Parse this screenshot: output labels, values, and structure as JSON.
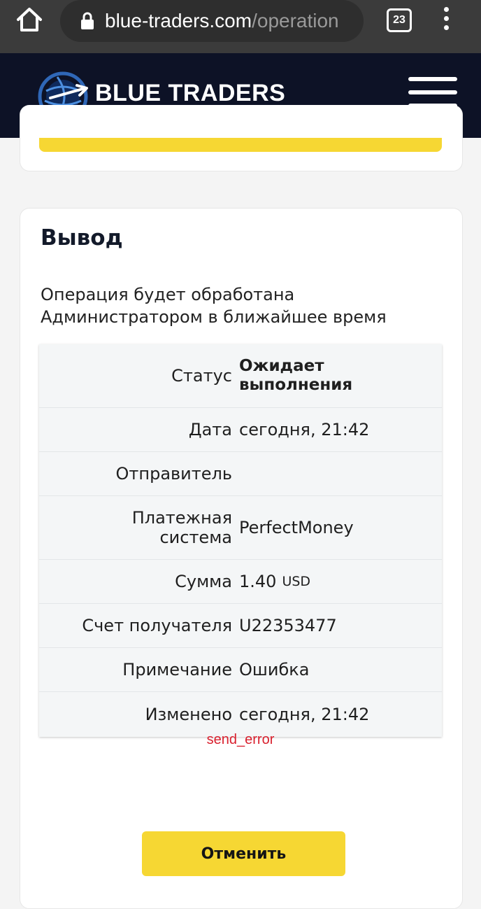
{
  "browser": {
    "url_domain": "blue-traders.com",
    "url_path": "/operation",
    "tab_count": "23"
  },
  "site": {
    "brand": "BLUE TRADERS"
  },
  "card": {
    "title": "Вывод",
    "description": "Операция будет обработана Администратором в ближайшее время"
  },
  "details": [
    {
      "label": "Статус",
      "value": "Ожидает выполнения"
    },
    {
      "label": "Дата",
      "value": "сегодня, 21:42"
    },
    {
      "label": "Отправитель",
      "value": ""
    },
    {
      "label": "Платежная система",
      "value": "PerfectMoney"
    },
    {
      "label": "Сумма",
      "value": "1.40",
      "currency": "USD"
    },
    {
      "label": "Счет получателя",
      "value": "U22353477"
    },
    {
      "label": "Примечание",
      "value": "Ошибка"
    },
    {
      "label": "Изменено",
      "value": "сегодня, 21:42"
    }
  ],
  "error_code": "send_error",
  "actions": {
    "cancel_label": "Отменить"
  },
  "colors": {
    "accent_yellow": "#f6d733",
    "header_bg": "#0d1226",
    "error_red": "#d9202e"
  }
}
